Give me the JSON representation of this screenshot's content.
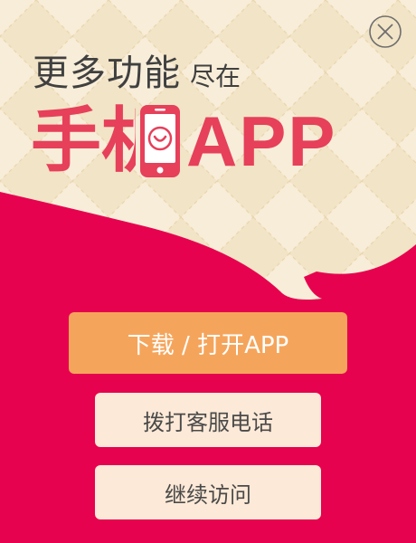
{
  "popup": {
    "headline_main": "更多功能",
    "headline_sub": "尽在",
    "app_title_char1": "手",
    "app_title_char2_partial": "机",
    "app_title_suffix": "APP",
    "phone_icon": "smiling-phone-icon",
    "close_icon": "close-circle-icon"
  },
  "buttons": {
    "download_open": "下载 / 打开APP",
    "call_support": "拨打客服电话",
    "continue_visit": "继续访问"
  },
  "colors": {
    "background_red": "#e6024f",
    "cream_pattern": "#f8edd6",
    "title_pink": "#e6405b",
    "primary_button": "#f5a55b",
    "secondary_button": "#fde9d7"
  }
}
